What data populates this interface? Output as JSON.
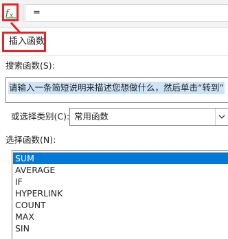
{
  "formula_bar": {
    "fx_icon": "fx-icon",
    "value": "="
  },
  "dialog": {
    "title": "插入函数",
    "search_label": "搜索函数(S):",
    "search_value": "请输入一条简短说明来描述您想做什么，然后单击“转到”",
    "category_label": "或选择类别(C):",
    "category_value": "常用函数",
    "category_dropdown_icon": "chevron-down-icon",
    "function_label": "选择函数(N):",
    "functions": [
      "SUM",
      "AVERAGE",
      "IF",
      "HYPERLINK",
      "COUNT",
      "MAX",
      "SIN"
    ],
    "selected_function": "SUM"
  },
  "colors": {
    "highlight_red": "#e0262b",
    "selection_blue": "#0078d7",
    "search_highlight": "#cde4f7"
  }
}
